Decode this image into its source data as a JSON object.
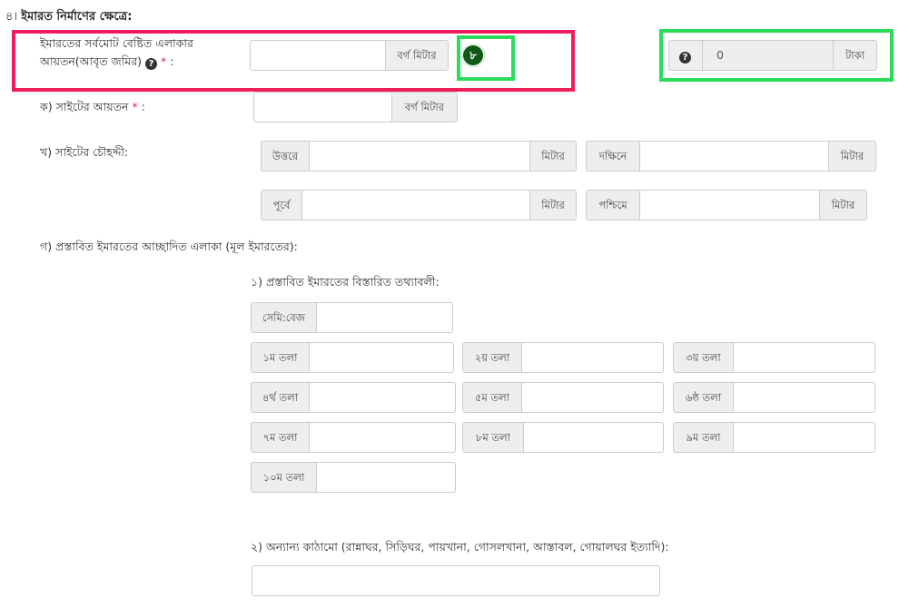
{
  "section": {
    "number": "৪।",
    "title": "ইমারত নির্মাণের ক্ষেত্রে:"
  },
  "total_area": {
    "label_line1": "ইমারতের সর্বমোট বেষ্টিত এলাকার",
    "label_line2": "আয়তন(আবৃত জমির)",
    "help_icon": "question-circle-icon",
    "required_mark": "*",
    "colon": ":",
    "value": "",
    "unit": "বর্গ মিটার",
    "badge": "৮",
    "fee_help_icon": "question-circle-icon",
    "fee_value": "0",
    "fee_unit": "টাকা"
  },
  "site_area": {
    "label": "ক) সাইটের আয়তন",
    "required_mark": "*",
    "colon": ":",
    "value": "",
    "unit": "বর্গ মিটার"
  },
  "boundary": {
    "label": "খ) সাইটের চৌহদ্দী:",
    "north": "উত্তরে",
    "south": "দক্ষিনে",
    "east": "পূর্বে",
    "west": "পশ্চিমে",
    "unit": "মিটার"
  },
  "covered_area": {
    "label": "গ) প্রস্তাবিত ইমারতের আচ্ছাদিত এলাকা (মূল ইমারতের):",
    "details_label": "১) প্রস্তাবিত ইমারতের বিস্তারিত তথ্যাবলী:",
    "semi_basement": "সেমি:বেজ",
    "floors": [
      "১ম তলা",
      "২য় তলা",
      "৩য় তলা",
      "৪র্থ তলা",
      "৫ম তলা",
      "৬ষ্ঠ তলা",
      "৭ম তলা",
      "৮ম তলা",
      "৯ম তলা",
      "১০ম তলা"
    ],
    "other_label": "২) অন্যান্য কাঠামো (রান্নাঘর, সিড়িঘর, পায়খানা, গোসলখানা, আস্তাবল, গোয়ালঘর ইত্যাদি):",
    "other_value": ""
  },
  "colors": {
    "highlight_red": "#ee1d5b",
    "highlight_green": "#2bdc5a",
    "badge_green": "#0f5a16"
  }
}
